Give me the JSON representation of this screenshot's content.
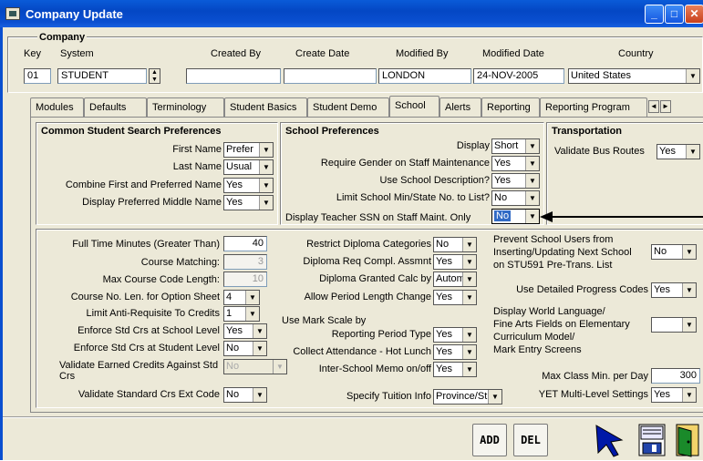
{
  "window": {
    "title": "Company Update"
  },
  "company": {
    "group_label": "Company",
    "key_label": "Key",
    "system_label": "System",
    "created_by_label": "Created By",
    "create_date_label": "Create Date",
    "modified_by_label": "Modified By",
    "modified_date_label": "Modified Date",
    "country_label": "Country",
    "key": "01",
    "system": "STUDENT",
    "created_by": "",
    "create_date": "",
    "modified_by": "LONDON",
    "modified_date": "24-NOV-2005",
    "country": "United States"
  },
  "tabs": [
    "Modules",
    "Defaults",
    "Terminology",
    "Student Basics",
    "Student Demo",
    "School",
    "Alerts",
    "Reporting",
    "Reporting Program"
  ],
  "active_tab": "School",
  "common": {
    "title": "Common Student Search Preferences",
    "first_name_label": "First Name",
    "first_name": "Prefer",
    "last_name_label": "Last Name",
    "last_name": "Usual",
    "combine_label": "Combine First and Preferred Name",
    "combine": "Yes",
    "middle_label": "Display Preferred Middle Name",
    "middle": "Yes"
  },
  "school_pref": {
    "title": "School Preferences",
    "display_label": "Display",
    "display": "Short",
    "gender_label": "Require Gender on Staff Maintenance",
    "gender": "Yes",
    "desc_label": "Use School Description?",
    "desc": "Yes",
    "limit_label": "Limit School Min/State No. to List?",
    "limit": "No",
    "ssn_label": "Display Teacher SSN on Staff Maint. Only",
    "ssn": "No"
  },
  "transport": {
    "title": "Transportation",
    "bus_label": "Validate Bus Routes",
    "bus": "Yes"
  },
  "col1": {
    "ftm_label": "Full Time Minutes (Greater Than)",
    "ftm": "40",
    "cm_label": "Course Matching:",
    "cm": "3",
    "mcc_label": "Max Course Code Length:",
    "mcc": "10",
    "cnl_label": "Course No. Len. for Option Sheet",
    "cnl": "4",
    "lar_label": "Limit Anti-Requisite To Credits",
    "lar": "1",
    "escs_label": "Enforce Std Crs at School Level",
    "escs": "Yes",
    "escst_label": "Enforce Std Crs at Student Level",
    "escst": "No",
    "vec_label": "Validate Earned Credits Against Std Crs",
    "vec": "No",
    "vsce_label": "Validate Standard Crs Ext Code",
    "vsce": "No"
  },
  "col2": {
    "rdc_label": "Restrict Diploma Categories",
    "rdc": "No",
    "drc_label": "Diploma Req Compl. Assmnt",
    "drc": "Yes",
    "dgc_label": "Diploma Granted Calc by",
    "dgc": "Autom",
    "aplc_label": "Allow Period Length Change",
    "aplc": "Yes",
    "ums_label1": "Use Mark Scale by",
    "ums_label2": "Reporting Period Type",
    "ums": "Yes",
    "cahl_label": "Collect Attendance - Hot Lunch",
    "cahl": "Yes",
    "ism_label": "Inter-School Memo on/off",
    "ism": "Yes",
    "sti_label": "Specify Tuition Info",
    "sti": "Province/St"
  },
  "col3": {
    "prev_label1": "Prevent School Users from",
    "prev_label2": "Inserting/Updating Next School",
    "prev_label3": "on STU591 Pre-Trans. List",
    "prev": "No",
    "udpc_label": "Use Detailed Progress Codes",
    "udpc": "Yes",
    "dwl_label1": "Display World Language/",
    "dwl_label2": "Fine Arts Fields on Elementary",
    "dwl_label3": "Curriculum Model/",
    "dwl_label4": "Mark Entry Screens",
    "dwl": "",
    "mcm_label": "Max Class Min. per Day",
    "mcm": "300",
    "yet_label": "YET Multi-Level Settings",
    "yet": "Yes"
  },
  "buttons": {
    "add": "ADD",
    "del": "DEL"
  },
  "colors": {
    "title_bar": "#0a4fd0",
    "frame": "#ece9d8",
    "highlight": "#316ac5"
  }
}
